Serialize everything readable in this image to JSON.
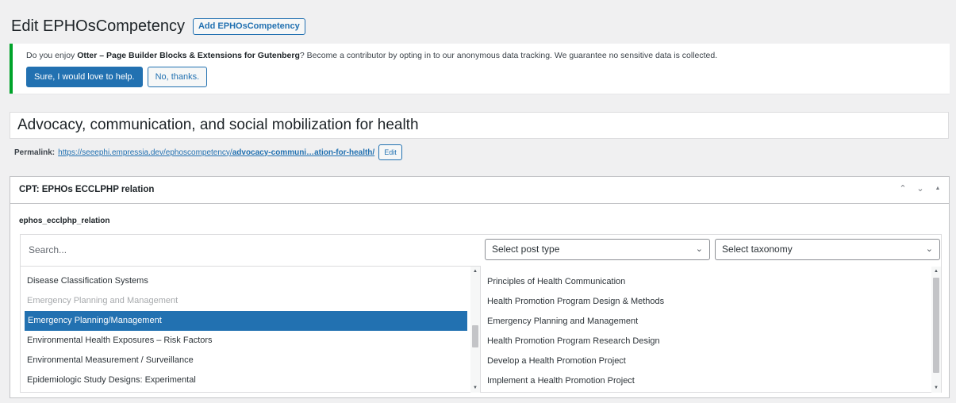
{
  "header": {
    "title": "Edit EPHOsCompetency",
    "add_button": "Add EPHOsCompetency"
  },
  "notice": {
    "text_before": "Do you enjoy ",
    "text_bold": "Otter – Page Builder Blocks & Extensions for Gutenberg",
    "text_after": "? Become a contributor by opting in to our anonymous data tracking. We guarantee no sensitive data is collected.",
    "accept_label": "Sure, I would love to help.",
    "decline_label": "No, thanks."
  },
  "post": {
    "title": "Advocacy, communication, and social mobilization for health",
    "permalink_label": "Permalink:",
    "permalink_base": "https://seeephi.empressia.dev/ephoscompetency/",
    "permalink_slug": "advocacy-communi…ation-for-health/",
    "edit_label": "Edit"
  },
  "metabox": {
    "title": "CPT: EPHOs ECCLPHP relation",
    "field_label": "ephos_ecclphp_relation",
    "search_placeholder": "Search...",
    "post_type_select": "Select post type",
    "taxonomy_select": "Select taxonomy",
    "left_items": [
      {
        "label": "Disease Classification Systems",
        "state": "normal"
      },
      {
        "label": "Emergency Planning and Management",
        "state": "disabled"
      },
      {
        "label": "Emergency Planning/Management",
        "state": "selected"
      },
      {
        "label": "Environmental Health Exposures – Risk Factors",
        "state": "normal"
      },
      {
        "label": "Environmental Measurement / Surveillance",
        "state": "normal"
      },
      {
        "label": "Epidemiologic Study Designs: Experimental",
        "state": "normal"
      }
    ],
    "right_items": [
      "Principles of Health Communication",
      "Health Promotion Program Design & Methods",
      "Emergency Planning and Management",
      "Health Promotion Program Research Design",
      "Develop a Health Promotion Project",
      "Implement a Health Promotion Project"
    ]
  }
}
